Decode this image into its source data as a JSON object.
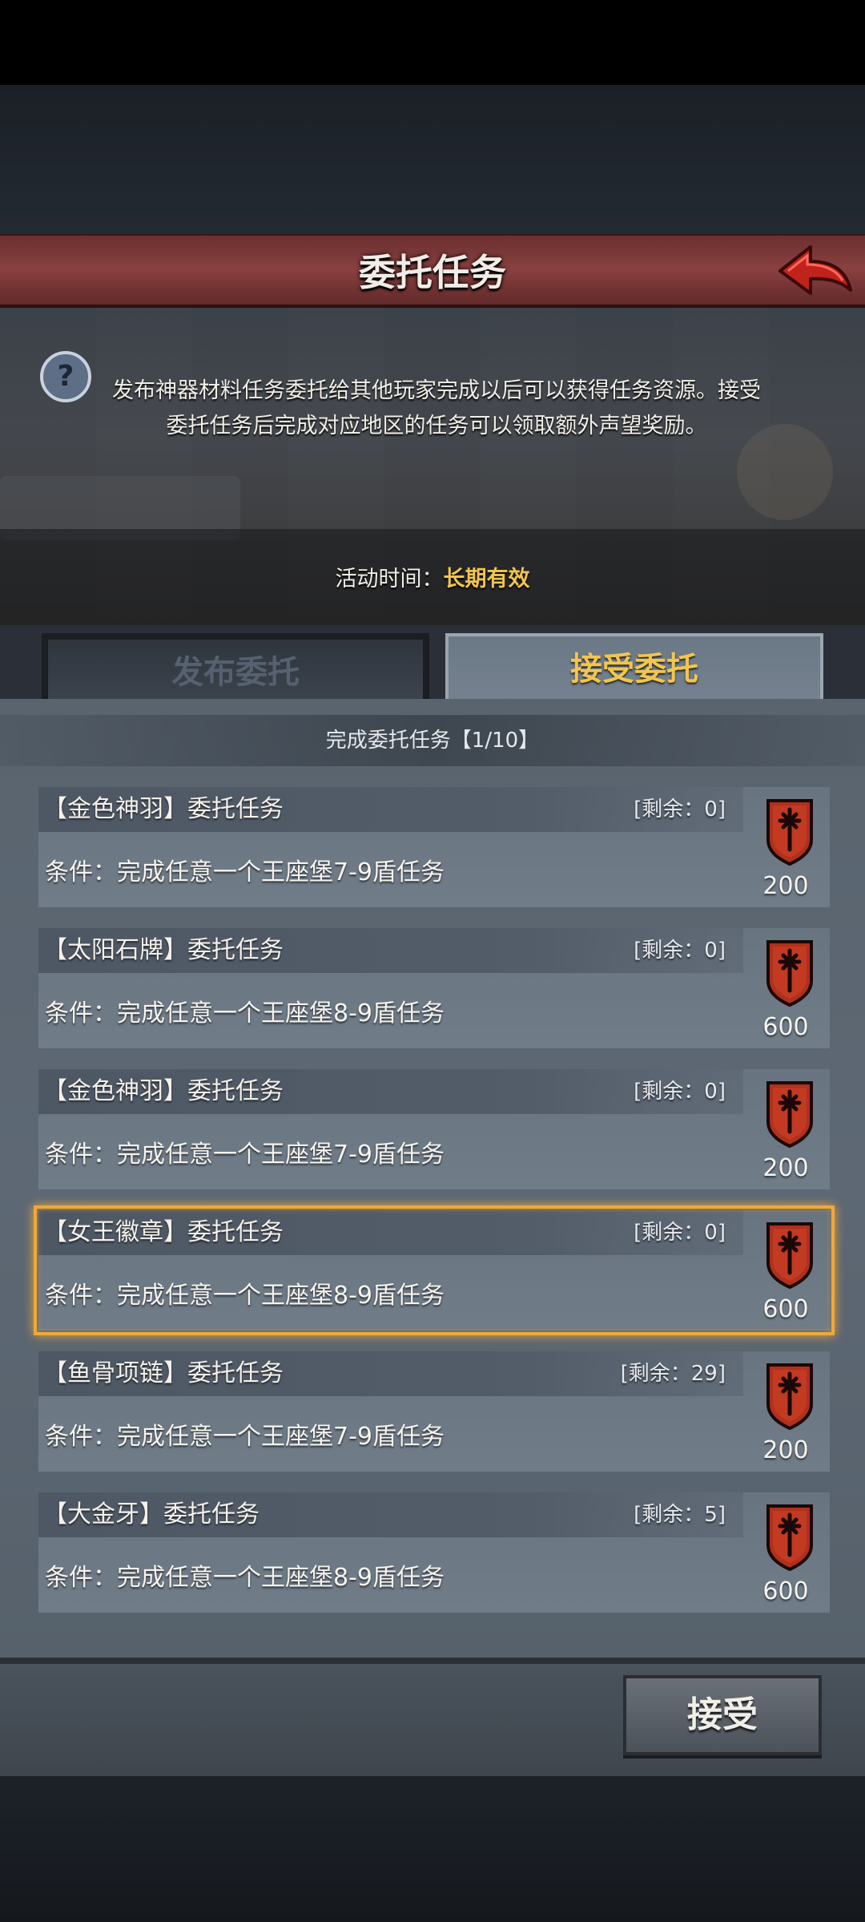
{
  "header": {
    "title": "委托任务"
  },
  "info": {
    "line1": "发布神器材料任务委托给其他玩家完成以后可以获得任务资源。接受",
    "line2": "委托任务后完成对应地区的任务可以领取额外声望奖励。",
    "time_label": "活动时间：",
    "time_value": "长期有效"
  },
  "tabs": [
    {
      "label": "发布委托",
      "active": false
    },
    {
      "label": "接受委托",
      "active": true
    }
  ],
  "progress": "完成委托任务【1/10】",
  "tasks": [
    {
      "name": "【金色神羽】委托任务",
      "remain": "[剩余：0]",
      "condition": "条件：完成任意一个王座堡7-9盾任务",
      "reward": "200"
    },
    {
      "name": "【太阳石牌】委托任务",
      "remain": "[剩余：0]",
      "condition": "条件：完成任意一个王座堡8-9盾任务",
      "reward": "600"
    },
    {
      "name": "【金色神羽】委托任务",
      "remain": "[剩余：0]",
      "condition": "条件：完成任意一个王座堡7-9盾任务",
      "reward": "200"
    },
    {
      "name": "【女王徽章】委托任务",
      "remain": "[剩余：0]",
      "condition": "条件：完成任意一个王座堡8-9盾任务",
      "reward": "600"
    },
    {
      "name": "【鱼骨项链】委托任务",
      "remain": "[剩余：29]",
      "condition": "条件：完成任意一个王座堡7-9盾任务",
      "reward": "200"
    },
    {
      "name": "【大金牙】委托任务",
      "remain": "[剩余：5]",
      "condition": "条件：完成任意一个王座堡8-9盾任务",
      "reward": "600"
    }
  ],
  "footer": {
    "accept_label": "接受"
  },
  "colors": {
    "accent": "#f2c54f",
    "title_bar": "#7a3838",
    "selection": "#f0a83a",
    "shield": "#b0301c"
  },
  "icons": {
    "back": "back-arrow-icon",
    "help": "question-icon",
    "reward": "reputation-shield-icon"
  }
}
